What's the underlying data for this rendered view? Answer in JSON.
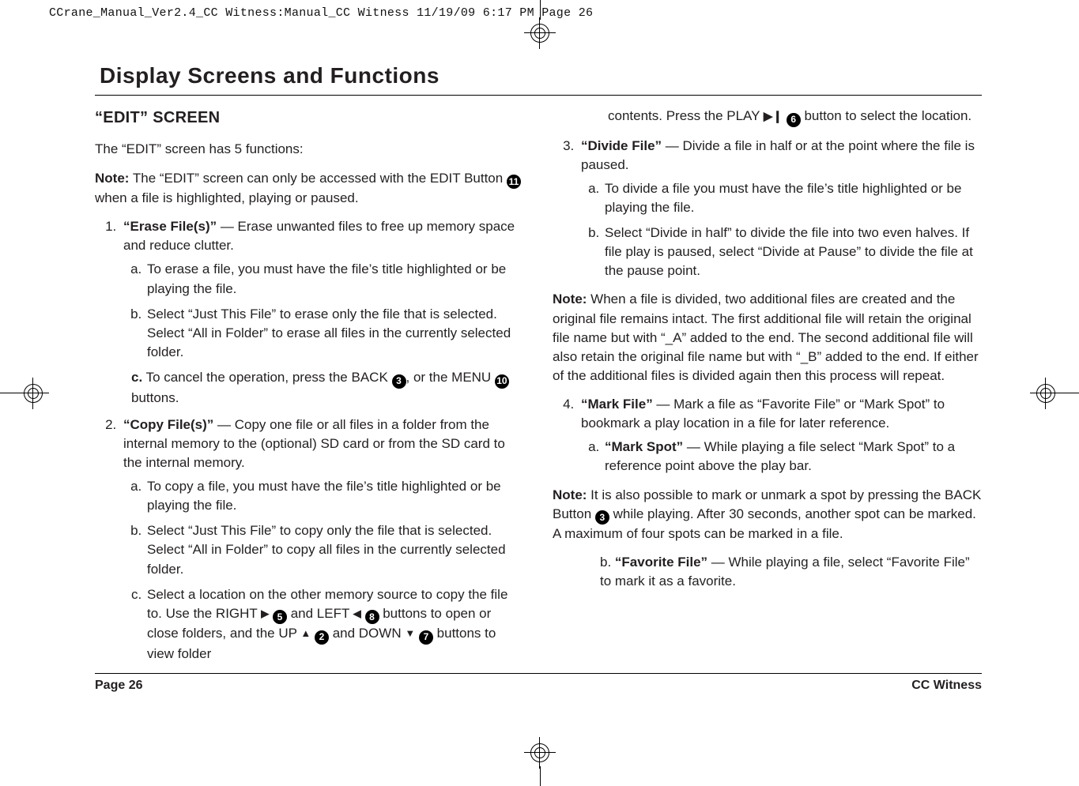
{
  "slug": "CCrane_Manual_Ver2.4_CC Witness:Manual_CC Witness  11/19/09  6:17 PM  Page 26",
  "section_title": "Display Screens and Functions",
  "heading": "“EDIT” SCREEN",
  "intro": "The “EDIT” screen has 5 functions:",
  "note1": {
    "label": "Note:",
    "pre": " The “EDIT” screen can only be accessed with the EDIT Button ",
    "badge": "11",
    "post": " when a file is highlighted, playing or paused."
  },
  "items": {
    "erase": {
      "title": "“Erase File(s)”",
      "desc": " — Erase unwanted files to free up memory space and reduce clutter.",
      "a": "To erase a file, you must have the file’s title highlighted or be playing the file.",
      "b": "Select “Just This File” to erase only the file that is selected. Select “All in Folder” to erase all files in the currently selected folder.",
      "c_label": "c.",
      "c_pre": " To cancel the operation, press the BACK ",
      "c_mid": ", or the MENU ",
      "c_post": " buttons.",
      "c_badge1": "3",
      "c_badge2": "10"
    },
    "copy": {
      "title": "“Copy File(s)”",
      "desc": " — Copy one file or all files in a folder from the internal memory to the (optional) SD card or from the SD card to the internal memory.",
      "a": "To copy a file, you must have the file’s title highlighted or be playing the file.",
      "b": "Select “Just This File” to copy only the file that is selected. Select “All in Folder” to copy all files in the currently selected folder.",
      "c_pre": "Select a location on the other memory source to copy the file to. Use the RIGHT ",
      "c_mid1": " and LEFT ",
      "c_mid2": " buttons to open or close folders, and the UP ",
      "c_mid3": " and DOWN ",
      "c_post": " buttons to view folder",
      "badge_right": "5",
      "badge_left": "8",
      "badge_up": "2",
      "badge_down": "7"
    },
    "copy_cont": {
      "pre": "contents. Press the PLAY ",
      "post": " button to select the location.",
      "badge": "6"
    },
    "divide": {
      "title": "“Divide File”",
      "desc": " — Divide a file in half or at the point where the file is paused.",
      "a": "To divide a file you must have the file’s title highlighted or be playing the file.",
      "b": "Select “Divide in half” to divide the file into two even halves. If file play is paused, select “Divide at Pause” to divide the file at the pause point."
    },
    "mark": {
      "title": "“Mark File”",
      "desc": " — Mark a file as “Favorite File” or “Mark Spot” to bookmark a play location in a file for later reference.",
      "a_title": "“Mark Spot”",
      "a_desc": " — While playing a file select “Mark Spot” to a reference point above the play bar.",
      "b_title": "“Favorite File”",
      "b_desc": " — While playing a file, select “Favorite File” to mark it as a favorite.",
      "b_label": "b.  "
    }
  },
  "note2": {
    "label": "Note:",
    "text": " When a file is divided, two additional files are created and the original file remains intact. The first additional file will retain the original file name but with “_A” added to the end. The second additional file will also retain the original file name but with “_B” added to the end.  If either of the additional files is divided again then this process will repeat."
  },
  "note3": {
    "label": "Note:",
    "pre": " It is also possible to mark or unmark a spot by pressing the BACK Button ",
    "post": " while playing. After 30 seconds, another spot can be marked. A maximum of four spots can be marked in a file.",
    "badge": "3"
  },
  "footer": {
    "page": "Page 26",
    "product": "CC Witness"
  },
  "glyphs": {
    "right": "▶",
    "left": "◀",
    "up": "▲",
    "down": "▼",
    "play_pause": "▶❙"
  }
}
